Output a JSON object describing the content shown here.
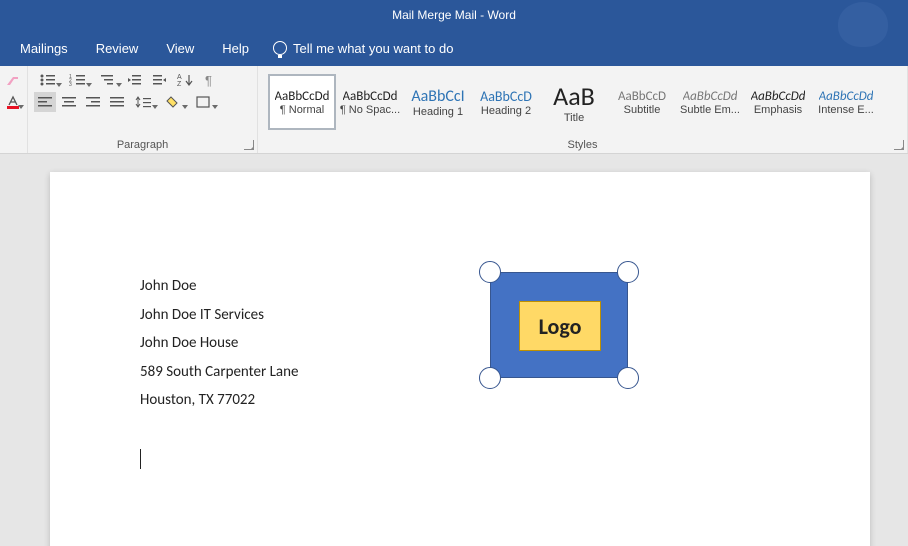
{
  "titlebar": {
    "title": "Mail Merge Mail  -  Word"
  },
  "menu": {
    "items": [
      "Mailings",
      "Review",
      "View",
      "Help"
    ],
    "tellme": "Tell me what you want to do"
  },
  "ribbon": {
    "paragraph_label": "Paragraph",
    "styles_label": "Styles",
    "styles": [
      {
        "sample": "AaBbCcDd",
        "name": "¶ Normal",
        "size": "13px",
        "color": "#222",
        "italic": false,
        "selected": true
      },
      {
        "sample": "AaBbCcDd",
        "name": "¶ No Spac...",
        "size": "13px",
        "color": "#222",
        "italic": false
      },
      {
        "sample": "AaBbCcI",
        "name": "Heading 1",
        "size": "16px",
        "color": "#2e74b5",
        "italic": false
      },
      {
        "sample": "AaBbCcD",
        "name": "Heading 2",
        "size": "14px",
        "color": "#2e74b5",
        "italic": false
      },
      {
        "sample": "AaB",
        "name": "Title",
        "size": "26px",
        "color": "#222",
        "italic": false
      },
      {
        "sample": "AaBbCcD",
        "name": "Subtitle",
        "size": "13px",
        "color": "#777",
        "italic": false
      },
      {
        "sample": "AaBbCcDd",
        "name": "Subtle Em...",
        "size": "13px",
        "color": "#777",
        "italic": true
      },
      {
        "sample": "AaBbCcDd",
        "name": "Emphasis",
        "size": "13px",
        "color": "#222",
        "italic": true
      },
      {
        "sample": "AaBbCcDd",
        "name": "Intense E...",
        "size": "13px",
        "color": "#2e74b5",
        "italic": true
      }
    ]
  },
  "document": {
    "address": [
      "John Doe",
      "John Doe IT Services",
      "John Doe House",
      "589 South Carpenter Lane",
      "Houston, TX 77022"
    ],
    "logo_text": "Logo"
  }
}
